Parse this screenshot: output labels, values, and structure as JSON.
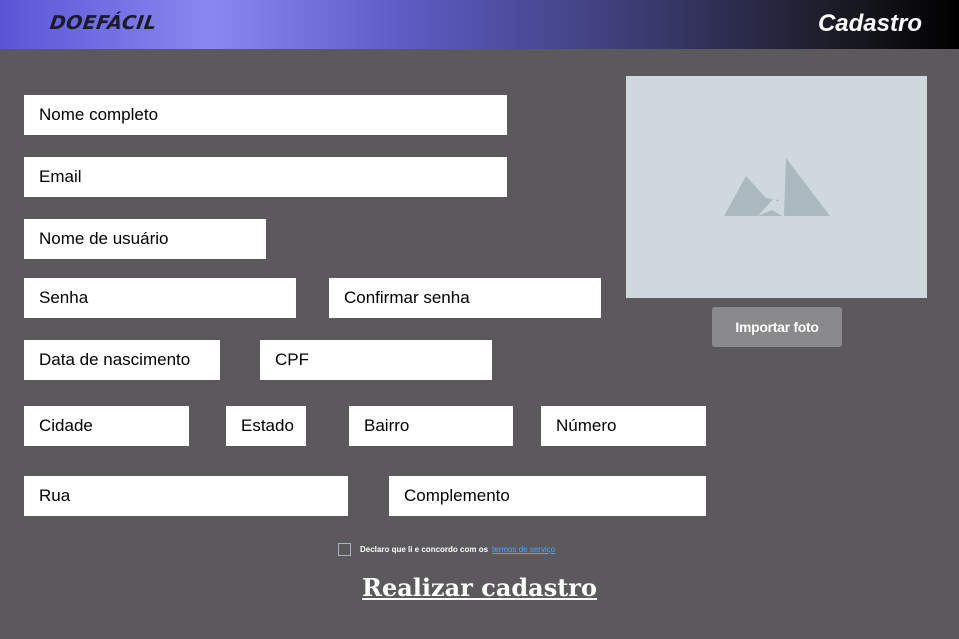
{
  "header": {
    "logo": "DOEFÁCIL",
    "title": "Cadastro"
  },
  "form": {
    "nome_completo": "Nome completo",
    "email": "Email",
    "nome_usuario": "Nome de usuário",
    "senha": "Senha",
    "confirmar_senha": "Confirmar senha",
    "data_nascimento": "Data de nascimento",
    "cpf": "CPF",
    "cidade": "Cidade",
    "estado": "Estado",
    "bairro": "Bairro",
    "numero": "Número",
    "rua": "Rua",
    "complemento": "Complemento"
  },
  "photo": {
    "icon": "image-placeholder-icon",
    "import_label": "Importar foto"
  },
  "terms": {
    "text": "Declaro que li e concordo com os",
    "link": "termos de serviço",
    "checked": false
  },
  "submit": {
    "label": "Realizar cadastro"
  },
  "colors": {
    "background": "#5b595c",
    "field": "#ffffff",
    "photo_bg": "#cfd8dd",
    "link": "#4fa3ff",
    "header_gradient": [
      "#5b55d6",
      "#8a88f0",
      "#000000"
    ]
  }
}
